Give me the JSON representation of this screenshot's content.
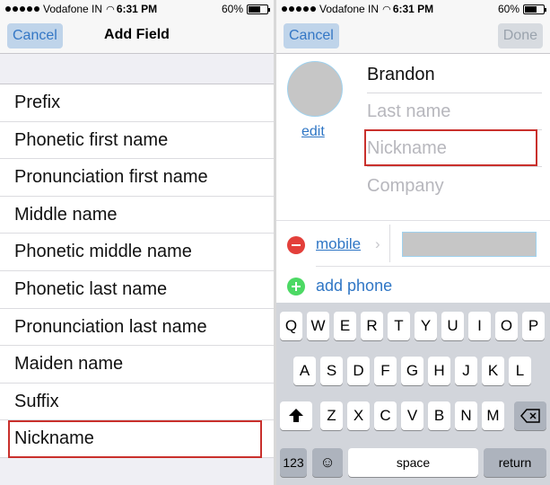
{
  "left": {
    "status": {
      "carrier": "Vodafone IN",
      "time": "6:31 PM",
      "battery": "60%"
    },
    "nav": {
      "cancel": "Cancel",
      "title": "Add Field"
    },
    "items": [
      "Prefix",
      "Phonetic first name",
      "Pronunciation first name",
      "Middle name",
      "Phonetic middle name",
      "Phonetic last name",
      "Pronunciation last name",
      "Maiden name",
      "Suffix",
      "Nickname"
    ]
  },
  "right": {
    "status": {
      "carrier": "Vodafone IN",
      "time": "6:31 PM",
      "battery": "60%"
    },
    "nav": {
      "cancel": "Cancel",
      "done": "Done"
    },
    "edit": "edit",
    "first_name": "Brandon",
    "last_name_ph": "Last name",
    "nickname_ph": "Nickname",
    "company_ph": "Company",
    "phone_label": "mobile",
    "add_phone": "add phone",
    "keyboard": {
      "row1": [
        "Q",
        "W",
        "E",
        "R",
        "T",
        "Y",
        "U",
        "I",
        "O",
        "P"
      ],
      "row2": [
        "A",
        "S",
        "D",
        "F",
        "G",
        "H",
        "J",
        "K",
        "L"
      ],
      "row3": [
        "Z",
        "X",
        "C",
        "V",
        "B",
        "N",
        "M"
      ],
      "numbers": "123",
      "space": "space",
      "return": "return"
    }
  }
}
